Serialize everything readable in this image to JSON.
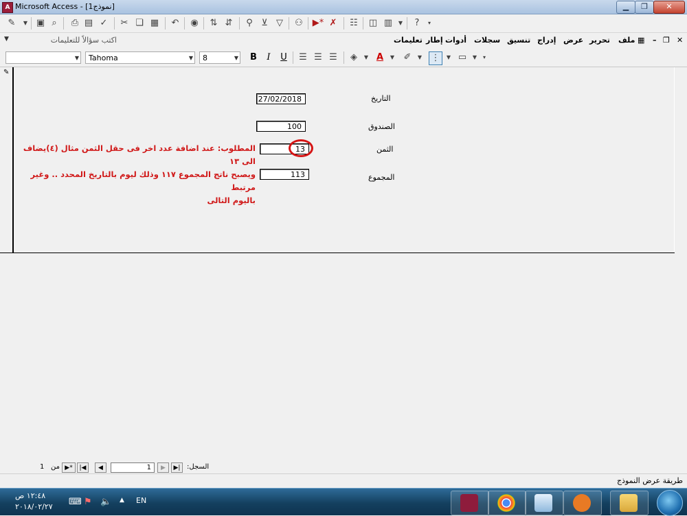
{
  "window": {
    "title": "Microsoft Access - [نموذج1]",
    "app_icon": "access-key-icon",
    "min_glyph": "▁",
    "max_glyph": "❐",
    "close_glyph": "✕"
  },
  "menu": {
    "items": [
      "ملف",
      "تحرير",
      "عرض",
      "إدراج",
      "تنسيق",
      "سجلات",
      "أدوات",
      "إطار",
      "تعليمات"
    ],
    "help_box_placeholder": "اكتب سؤالاً للتعليمات",
    "menu_close_glyph": "✕",
    "menu_restore_glyph": "❐"
  },
  "format_bar": {
    "object_value": "",
    "font_name": "Tahoma",
    "font_size": "8",
    "bold": "B",
    "italic": "I",
    "underline": "U",
    "font_color_letter": "A"
  },
  "form": {
    "fields": [
      {
        "label": "التاريخ",
        "value": "27/02/2018"
      },
      {
        "label": "الصندوق",
        "value": "100"
      },
      {
        "label": "الثمن",
        "value": "13"
      },
      {
        "label": "المجموع",
        "value": "113"
      }
    ],
    "annotation_lines": [
      "المطلوب: عند اضافة عدد اخر فى حقل الثمن مثال (٤)يضاف الى ١٣",
      "ويصبح ناتج المجموع ١١٧ وذلك ليوم بالتاريخ المحدد .. وغير مرتبط",
      "باليوم التالى"
    ]
  },
  "navigator": {
    "record_label": "السجل:",
    "current": "1",
    "of_label": "من",
    "total": "1",
    "first_glyph": "|◀",
    "prev_glyph": "◀",
    "next_glyph": "▶",
    "last_glyph": "▶|",
    "new_glyph": "▶*"
  },
  "status": {
    "text": "طريقة عرض النموذج"
  },
  "taskbar": {
    "clock_time": "١٢:٤٨ ص",
    "clock_date": "٢٠١٨/٠٢/٢٧",
    "language": "EN",
    "apps": [
      "access-icon",
      "chrome-icon",
      "notepad-icon",
      "media-player-icon",
      "explorer-icon"
    ]
  },
  "colors": {
    "annotation": "#d01818",
    "circle": "#d51414",
    "taskbar": "#14405f"
  }
}
